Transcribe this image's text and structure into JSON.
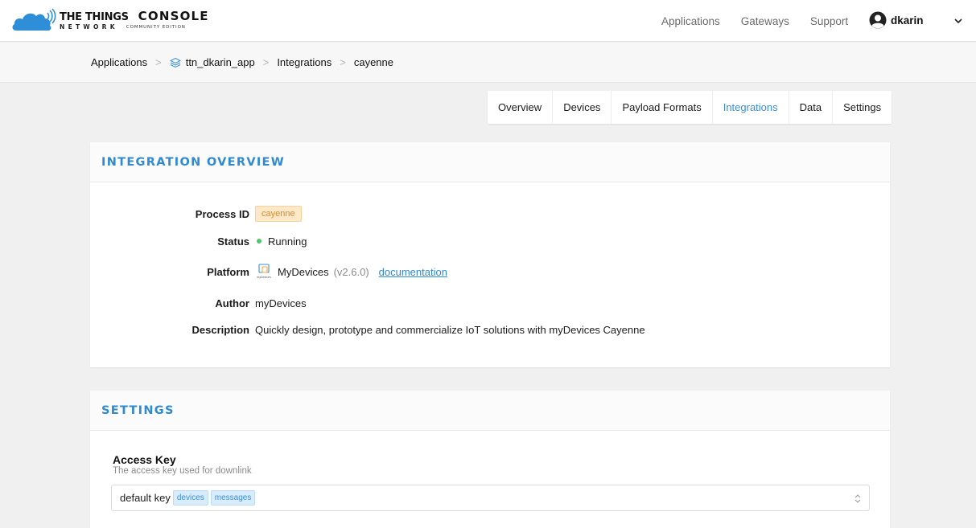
{
  "brand": {
    "name_line1": "THE THINGS",
    "name_line2": "NETWORK",
    "console": "CONSOLE",
    "edition": "COMMUNITY EDITION",
    "accent": "#2f8ad0"
  },
  "nav": {
    "links": [
      "Applications",
      "Gateways",
      "Support"
    ],
    "user": "dkarin"
  },
  "breadcrumb": {
    "items": [
      "Applications",
      "ttn_dkarin_app",
      "Integrations",
      "cayenne"
    ]
  },
  "tabs": {
    "items": [
      "Overview",
      "Devices",
      "Payload Formats",
      "Integrations",
      "Data",
      "Settings"
    ],
    "active": "Integrations"
  },
  "overview": {
    "title": "INTEGRATION OVERVIEW",
    "process_id_label": "Process ID",
    "process_id": "cayenne",
    "status_label": "Status",
    "status": "Running",
    "status_color": "#4cc96b",
    "platform_label": "Platform",
    "platform_icon_text": "myDevices",
    "platform": "MyDevices",
    "version": "(v2.6.0)",
    "doc_link": "documentation",
    "author_label": "Author",
    "author": "myDevices",
    "description_label": "Description",
    "description": "Quickly design, prototype and commercialize IoT solutions with myDevices Cayenne"
  },
  "settings": {
    "title": "SETTINGS",
    "access_key_label": "Access Key",
    "access_key_help": "The access key used for downlink",
    "access_key_value": "default key",
    "access_key_tags": [
      "devices",
      "messages"
    ]
  }
}
